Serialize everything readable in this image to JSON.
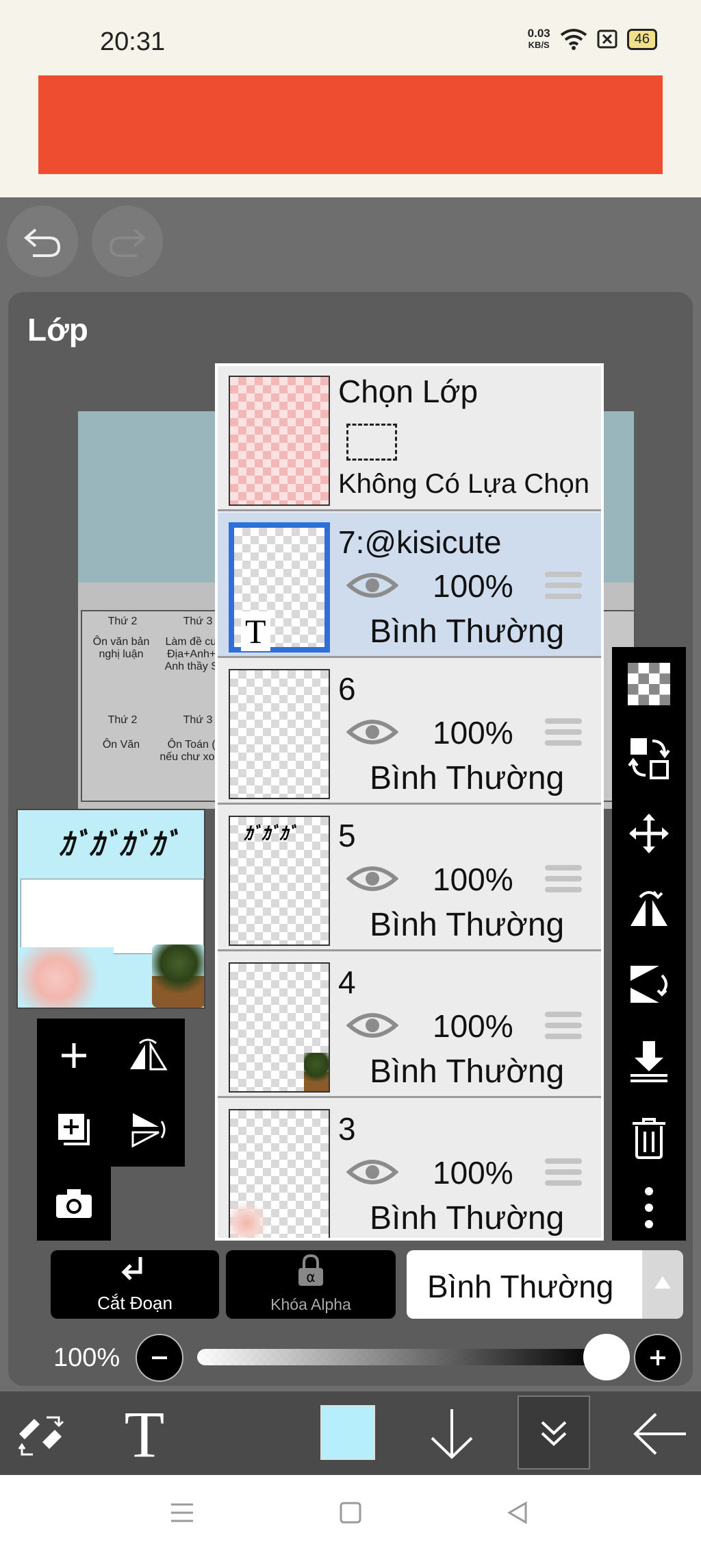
{
  "status": {
    "time": "20:31",
    "speed_value": "0.03",
    "speed_unit": "KB/S",
    "battery": "46"
  },
  "panel": {
    "title": "Lớp"
  },
  "background_doc": {
    "table_headers": [
      "Thứ 2",
      "Thứ 3"
    ],
    "row1": [
      "Ôn văn bản nghị luận",
      "Làm đề cươ Địa+Anh+B Anh thầy Sơ"
    ],
    "row2": [
      "Ôn Văn",
      "Ôn Toán (S nếu chư xong)"
    ]
  },
  "selection_row": {
    "title": "Chọn Lớp",
    "subtitle": "Không Có Lựa Chọn"
  },
  "layers": [
    {
      "name": "7:@kisicute",
      "opacity": "100%",
      "blend": "Bình Thường",
      "selected": true,
      "type": "text"
    },
    {
      "name": "6",
      "opacity": "100%",
      "blend": "Bình Thường",
      "selected": false
    },
    {
      "name": "5",
      "opacity": "100%",
      "blend": "Bình Thường",
      "selected": false
    },
    {
      "name": "4",
      "opacity": "100%",
      "blend": "Bình Thường",
      "selected": false
    },
    {
      "name": "3",
      "opacity": "100%",
      "blend": "Bình Thường",
      "selected": false
    }
  ],
  "bottom": {
    "clip_label": "Cắt Đoạn",
    "alpha_lock_label": "Khóa Alpha",
    "blend_mode": "Bình Thường",
    "opacity_label": "100%",
    "opacity_value": 1.0
  },
  "colors": {
    "ad_banner": "#ee4e2f",
    "selected_layer": "#cfdcee",
    "current_color": "#b6eefc"
  },
  "icons": {
    "undo": "undo-icon",
    "redo": "redo-icon",
    "eye": "eye-icon",
    "text_tool": "T"
  }
}
